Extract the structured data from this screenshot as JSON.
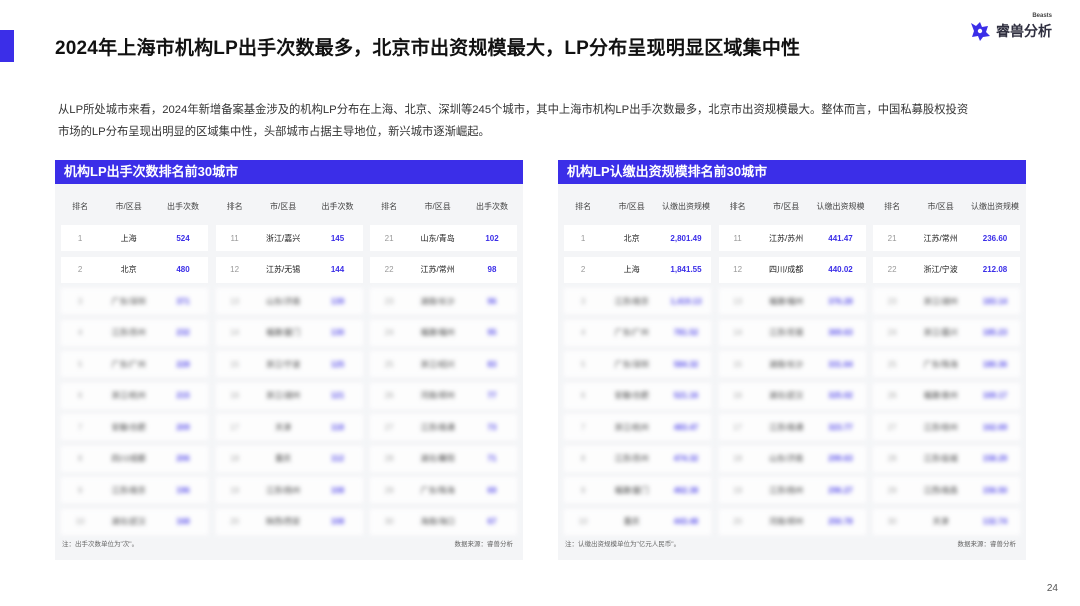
{
  "title": "2024年上海市机构LP出手次数最多，北京市出资规模最大，LP分布呈现明显区域集中性",
  "logo": {
    "text": "睿兽分析",
    "sub": "Beasts"
  },
  "intro_lines": [
    "从LP所处城市来看，2024年新增备案基金涉及的机构LP分布在上海、北京、深圳等245个城市，其中上海市机构LP出手次数最多，北京市出资规模最大。整体而言，中国私募股权投资",
    "市场的LP分布呈现出明显的区域集中性，头部城市占据主导地位，新兴城市逐渐崛起。"
  ],
  "left_panel": {
    "header": "机构LP出手次数排名前30城市",
    "columns": [
      "排名",
      "市/区县",
      "出手次数"
    ],
    "groups": [
      [
        [
          "1",
          "上海",
          "524"
        ],
        [
          "2",
          "北京",
          "480"
        ],
        [
          "3",
          "广东/深圳",
          "371"
        ],
        [
          "4",
          "江苏/苏州",
          "232"
        ],
        [
          "5",
          "广东/广州",
          "228"
        ],
        [
          "6",
          "浙江/杭州",
          "215"
        ],
        [
          "7",
          "安徽/合肥",
          "209"
        ],
        [
          "8",
          "四川/成都",
          "206"
        ],
        [
          "9",
          "江苏/南京",
          "196"
        ],
        [
          "10",
          "湖北/武汉",
          "168"
        ]
      ],
      [
        [
          "11",
          "浙江/嘉兴",
          "145"
        ],
        [
          "12",
          "江苏/无锡",
          "144"
        ],
        [
          "13",
          "山东/济南",
          "139"
        ],
        [
          "14",
          "福建/厦门",
          "130"
        ],
        [
          "15",
          "浙江/宁波",
          "125"
        ],
        [
          "16",
          "浙江/湖州",
          "121"
        ],
        [
          "17",
          "天津",
          "118"
        ],
        [
          "18",
          "重庆",
          "112"
        ],
        [
          "19",
          "江苏/扬州",
          "108"
        ],
        [
          "20",
          "陕西/西安",
          "108"
        ]
      ],
      [
        [
          "21",
          "山东/青岛",
          "102"
        ],
        [
          "22",
          "江苏/常州",
          "98"
        ],
        [
          "23",
          "湖南/长沙",
          "96"
        ],
        [
          "24",
          "福建/福州",
          "95"
        ],
        [
          "25",
          "浙江/绍兴",
          "83"
        ],
        [
          "26",
          "河南/郑州",
          "77"
        ],
        [
          "27",
          "江苏/南通",
          "73"
        ],
        [
          "28",
          "湖北/襄阳",
          "71"
        ],
        [
          "29",
          "广东/珠海",
          "69"
        ],
        [
          "30",
          "海南/海口",
          "67"
        ]
      ]
    ],
    "note": "注：出手次数单位为\"次\"。",
    "source": "数据来源：睿兽分析"
  },
  "right_panel": {
    "header": "机构LP认缴出资规模排名前30城市",
    "columns": [
      "排名",
      "市/区县",
      "认缴出资规模"
    ],
    "groups": [
      [
        [
          "1",
          "北京",
          "2,801.49"
        ],
        [
          "2",
          "上海",
          "1,841.55"
        ],
        [
          "3",
          "江苏/南京",
          "1,419.13"
        ],
        [
          "4",
          "广东/广州",
          "781.52"
        ],
        [
          "5",
          "广东/深圳",
          "584.32"
        ],
        [
          "6",
          "安徽/合肥",
          "521.16"
        ],
        [
          "7",
          "浙江/杭州",
          "483.47"
        ],
        [
          "8",
          "江苏/苏州",
          "474.32"
        ],
        [
          "9",
          "福建/厦门",
          "462.38"
        ],
        [
          "10",
          "重庆",
          "443.48"
        ]
      ],
      [
        [
          "11",
          "江苏/苏州",
          "441.47"
        ],
        [
          "12",
          "四川/成都",
          "440.02"
        ],
        [
          "13",
          "福建/福州",
          "376.28"
        ],
        [
          "14",
          "江苏/无锡",
          "369.63"
        ],
        [
          "15",
          "湖南/长沙",
          "331.64"
        ],
        [
          "16",
          "湖北/武汉",
          "325.02"
        ],
        [
          "17",
          "江苏/南通",
          "323.77"
        ],
        [
          "18",
          "山东/济南",
          "299.63"
        ],
        [
          "19",
          "江苏/扬州",
          "296.27"
        ],
        [
          "20",
          "河南/郑州",
          "250.78"
        ]
      ],
      [
        [
          "21",
          "江苏/常州",
          "236.60"
        ],
        [
          "22",
          "浙江/宁波",
          "212.08"
        ],
        [
          "23",
          "浙江/湖州",
          "183.14"
        ],
        [
          "24",
          "浙江/嘉兴",
          "185.23"
        ],
        [
          "25",
          "广东/珠海",
          "180.36"
        ],
        [
          "26",
          "福建/泉州",
          "169.17"
        ],
        [
          "27",
          "江苏/徐州",
          "162.69"
        ],
        [
          "28",
          "江苏/盐城",
          "158.29"
        ],
        [
          "29",
          "江西/南昌",
          "156.50"
        ],
        [
          "30",
          "天津",
          "132.74"
        ]
      ]
    ],
    "note": "注：认缴出资规模单位为\"亿元人民币\"。",
    "source": "数据来源：睿兽分析"
  },
  "page_number": "24",
  "colors": {
    "accent": "#3b2ee8",
    "panel_bg": "#f4f5f7"
  }
}
